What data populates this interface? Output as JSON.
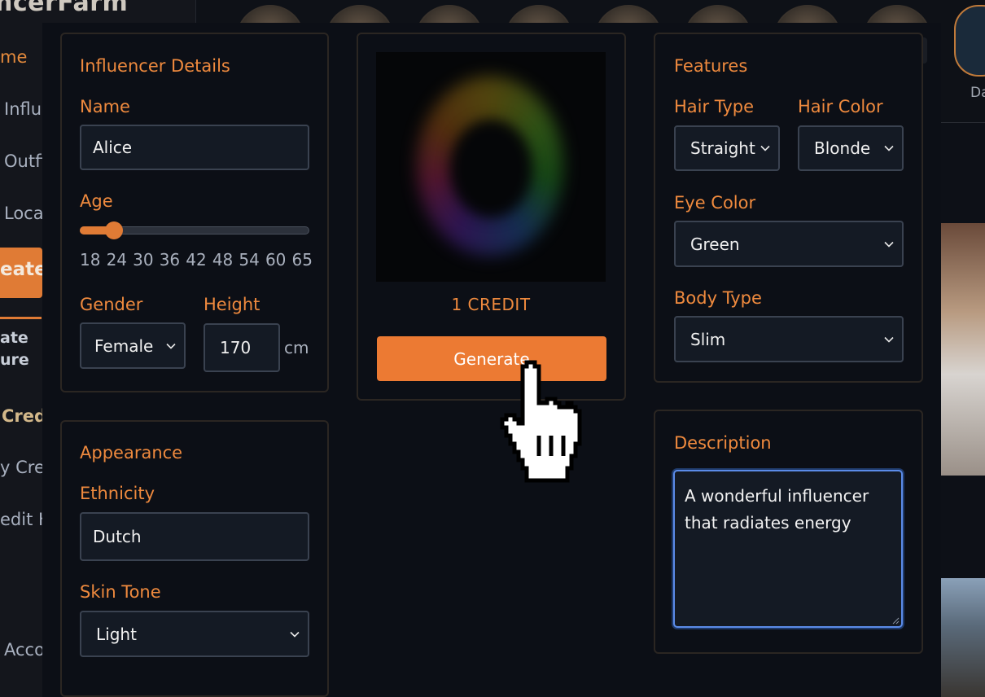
{
  "background": {
    "logo": "ncerFarm",
    "nav": [
      "me",
      "Influ",
      "Outfi",
      "Loca"
    ],
    "create_label": "eate",
    "sub_label": [
      "ate",
      "ure"
    ],
    "credits_heading": "Cred",
    "credit_links": [
      "y Cre",
      "edit H"
    ],
    "account": "Acco",
    "header_user_fragment": "Da"
  },
  "modal": {
    "details": {
      "title": "Influencer Details",
      "name_label": "Name",
      "name_value": "Alice",
      "age_label": "Age",
      "age_value_fraction": 0.15,
      "age_ticks": [
        "18",
        "24",
        "30",
        "36",
        "42",
        "48",
        "54",
        "60",
        "65"
      ],
      "gender_label": "Gender",
      "gender_value": "Female",
      "height_label": "Height",
      "height_value": "170",
      "height_unit": "cm"
    },
    "appearance": {
      "title": "Appearance",
      "ethnicity_label": "Ethnicity",
      "ethnicity_value": "Dutch",
      "skin_label": "Skin Tone",
      "skin_value": "Light"
    },
    "preview": {
      "credit_text": "1 CREDIT",
      "generate_label": "Generate"
    },
    "features": {
      "title": "Features",
      "hair_type_label": "Hair Type",
      "hair_type_value": "Straight",
      "hair_color_label": "Hair Color",
      "hair_color_value": "Blonde",
      "eye_label": "Eye Color",
      "eye_value": "Green",
      "body_label": "Body Type",
      "body_value": "Slim"
    },
    "description": {
      "title": "Description",
      "value": "A wonderful influencer that radiates energy"
    }
  },
  "colors": {
    "accent": "#ec7a33",
    "label": "#ef8a3e",
    "focus": "#5b8be8"
  }
}
